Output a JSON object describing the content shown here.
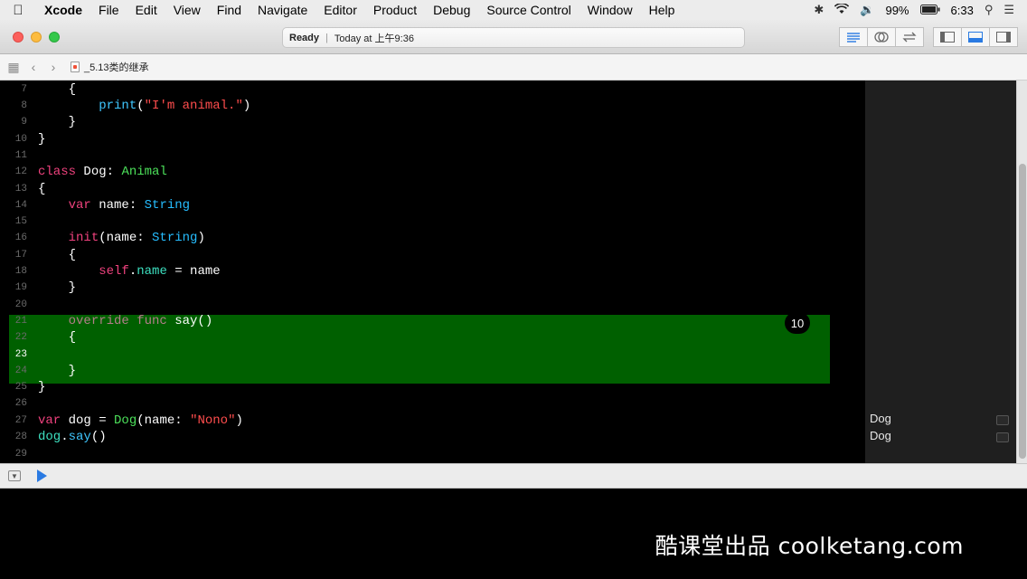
{
  "menubar": {
    "app_name": "Xcode",
    "items": [
      "File",
      "Edit",
      "View",
      "Find",
      "Navigate",
      "Editor",
      "Product",
      "Debug",
      "Source Control",
      "Window",
      "Help"
    ],
    "battery": "99%",
    "time": "6:33"
  },
  "toolbar": {
    "status": "Ready",
    "timestamp": "Today at 上午9:36"
  },
  "jumpbar": {
    "file_name": "_5.13类的继承"
  },
  "editor": {
    "current_line": 23,
    "highlight_lines": [
      21,
      22,
      23,
      24
    ],
    "badge": "10",
    "line_numbers": [
      "7",
      "8",
      "9",
      "10",
      "11",
      "12",
      "13",
      "14",
      "15",
      "16",
      "17",
      "18",
      "19",
      "20",
      "21",
      "22",
      "23",
      "24",
      "25",
      "26",
      "27",
      "28",
      "29"
    ]
  },
  "results": {
    "line27": "Dog",
    "line28": "Dog"
  },
  "watermark": "酷课堂出品 coolketang.com"
}
